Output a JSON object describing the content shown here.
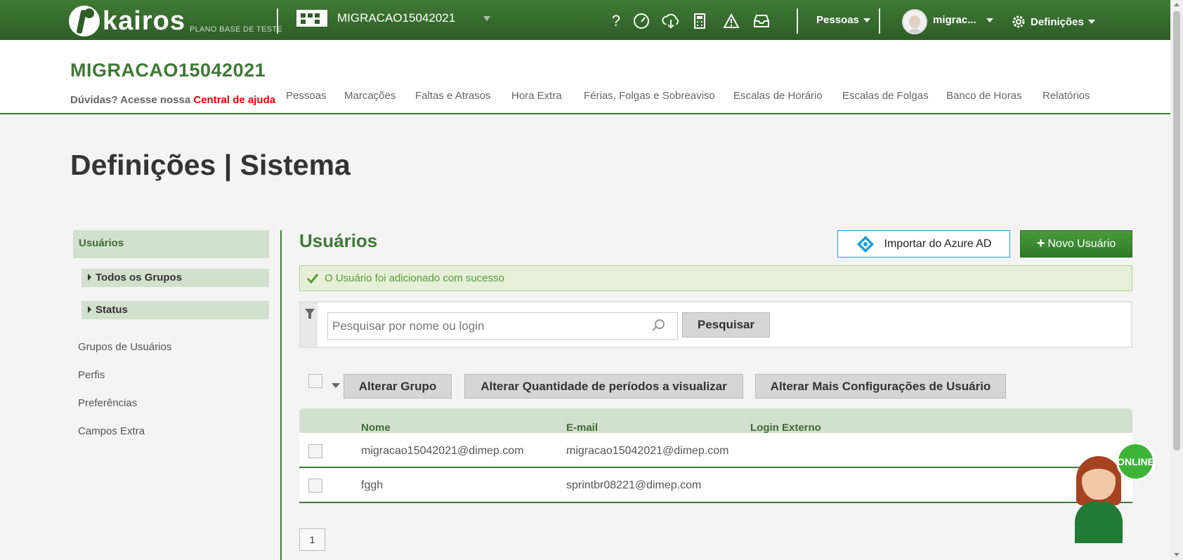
{
  "topbar": {
    "logo_text": "kairos",
    "logo_subtitle": "PLANO BASE DE TESTE",
    "company_selector": "MIGRACAO15042021",
    "icons": [
      "help-icon",
      "speedometer-icon",
      "cloud-sync-icon",
      "calculator-icon",
      "warning-icon",
      "inbox-icon"
    ],
    "people_menu": "Pessoas",
    "user_menu": "migrac...",
    "settings_menu": "Definições"
  },
  "header": {
    "company_title": "MIGRACAO15042021",
    "help_prefix": "Dúvidas? Acesse nossa",
    "help_link": "Central de ajuda",
    "nav": [
      "Pessoas",
      "Marcações",
      "Faltas e Atrasos",
      "Hora Extra",
      "Férias, Folgas e Sobreaviso",
      "Escalas de Horário",
      "Escalas de Folgas",
      "Banco de Horas",
      "Relatórios"
    ]
  },
  "page_title": "Definições | Sistema",
  "sidebar": {
    "active": "Usuários",
    "subitems": [
      "Todos os Grupos",
      "Status"
    ],
    "links": [
      "Grupos de Usuários",
      "Perfis",
      "Preferências",
      "Campos Extra"
    ]
  },
  "content": {
    "title": "Usuários",
    "import_button": "Importar do Azure AD",
    "new_button": "Novo Usuário",
    "alert": "O Usuário foi adicionado com sucesso",
    "search_placeholder": "Pesquisar por nome ou login",
    "search_button": "Pesquisar",
    "actions": [
      "Alterar Grupo",
      "Alterar Quantidade de períodos a visualizar",
      "Alterar Mais Configurações de Usuário"
    ],
    "columns": [
      "Nome",
      "E-mail",
      "Login Externo"
    ],
    "rows": [
      {
        "nome": "migracao15042021@dimep.com",
        "email": "migracao15042021@dimep.com",
        "login": ""
      },
      {
        "nome": "fggh",
        "email": "sprintbr08221@dimep.com",
        "login": ""
      }
    ],
    "page": "1"
  },
  "chat_badge": "ONLINE",
  "colors": {
    "brand_green": "#3f7a35",
    "help_red": "#e00000",
    "azure_blue": "#1a9ed8"
  }
}
